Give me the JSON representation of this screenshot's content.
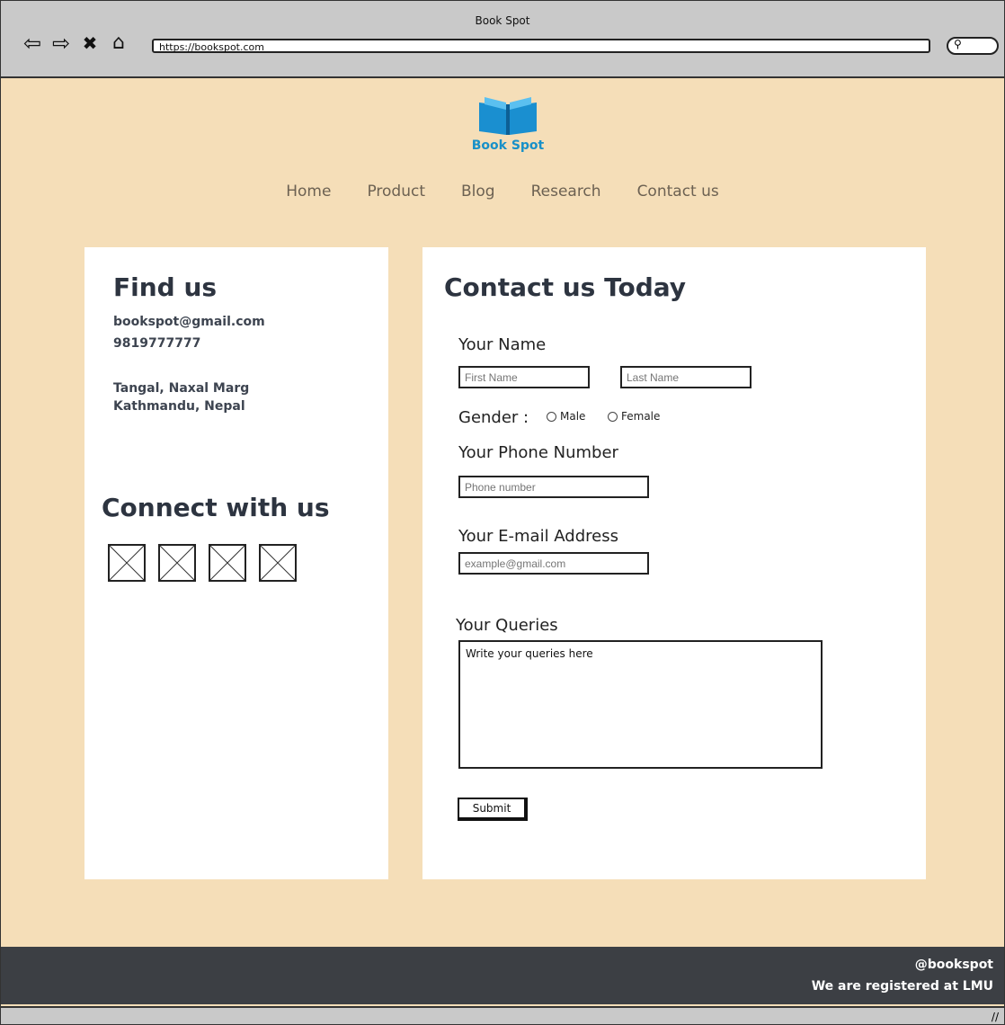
{
  "window": {
    "title": "Book Spot",
    "url": "https://bookspot.com"
  },
  "logo": {
    "text": "Book Spot"
  },
  "nav": [
    "Home",
    "Product",
    "Blog",
    "Research",
    "Contact us"
  ],
  "find": {
    "title": "Find us",
    "email": "bookspot@gmail.com",
    "phone": "9819777777",
    "address1": "Tangal, Naxal Marg",
    "address2": "Kathmandu, Nepal"
  },
  "connect": {
    "title": "Connect with us"
  },
  "form": {
    "title": "Contact us Today",
    "name_label": "Your Name",
    "first_placeholder": "First Name",
    "last_placeholder": "Last Name",
    "gender_label": "Gender :",
    "male": "Male",
    "female": "Female",
    "phone_label": "Your Phone Number",
    "phone_placeholder": "Phone number",
    "email_label": "Your E-mail Address",
    "email_placeholder": "example@gmail.com",
    "queries_label": "Your Queries",
    "queries_placeholder": "Write your queries here",
    "submit": "Submit"
  },
  "footer": {
    "handle": "@bookspot",
    "note": "We are registered at LMU"
  }
}
